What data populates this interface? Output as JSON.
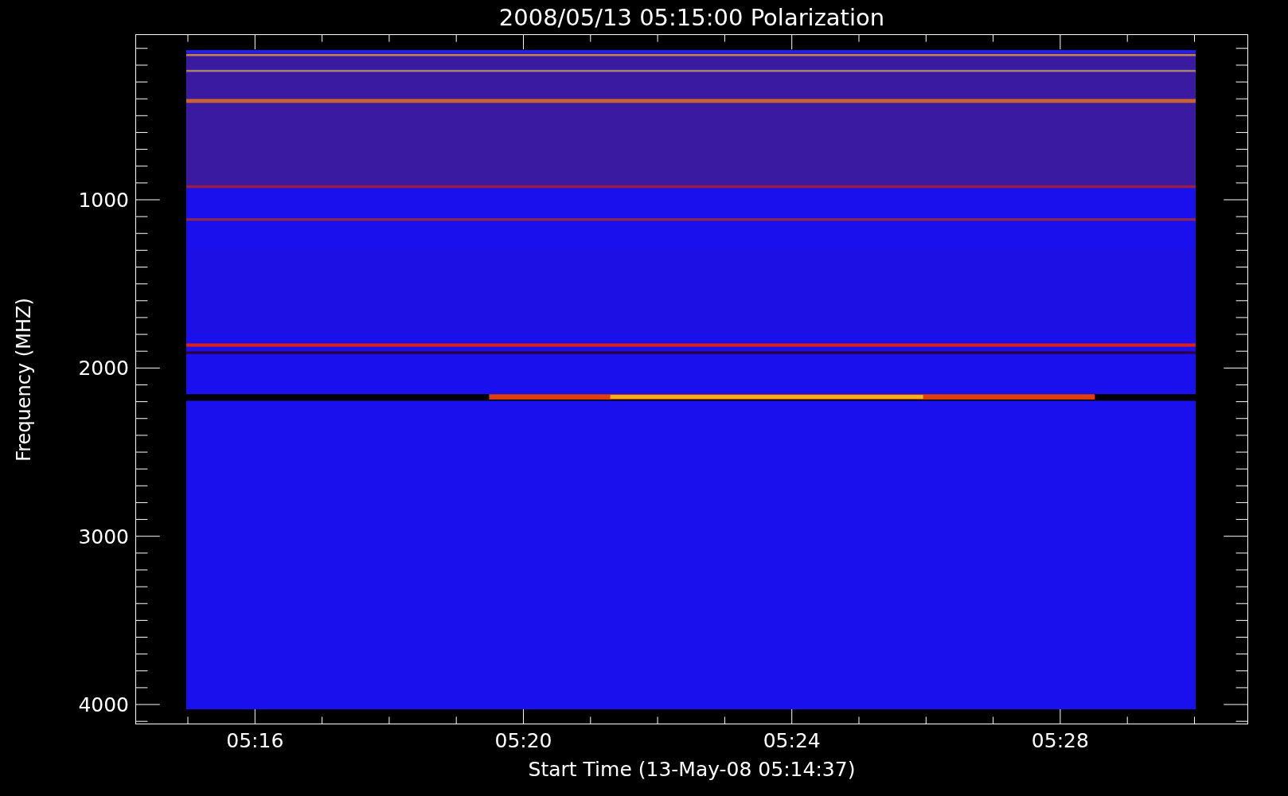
{
  "title": "2008/05/13 05:15:00 Polarization",
  "y_axis": {
    "label": "Frequency (MHZ)",
    "tick_labels": [
      "1000",
      "2000",
      "3000",
      "4000"
    ]
  },
  "x_axis": {
    "label": "Start Time (13-May-08 05:14:37)",
    "tick_labels": [
      "05:16",
      "05:20",
      "05:24",
      "05:28"
    ]
  }
}
